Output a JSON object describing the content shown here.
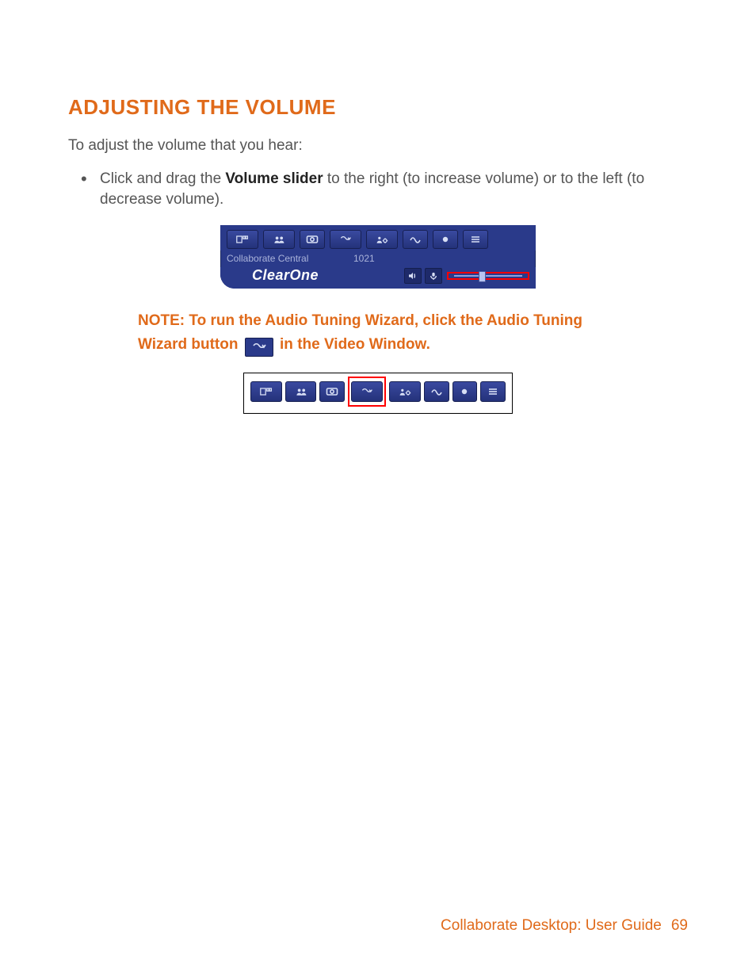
{
  "section": {
    "title": "ADJUSTING THE VOLUME",
    "intro": "To adjust the volume that you hear:",
    "bullet_pre": "Click and drag the ",
    "bullet_bold": "Volume slider",
    "bullet_post": " to the right (to increase volume) or to the left (to decrease volume)."
  },
  "fig1": {
    "status_label": "Collaborate Central",
    "status_value": "1021",
    "brand": "ClearOne"
  },
  "note": {
    "label": "NOTE:",
    "text_a": " To run the Audio Tuning Wizard, click the Audio Tuning Wizard button ",
    "text_b": " in the Video Window."
  },
  "footer": {
    "title": "Collaborate Desktop: User Guide",
    "page": "69"
  }
}
